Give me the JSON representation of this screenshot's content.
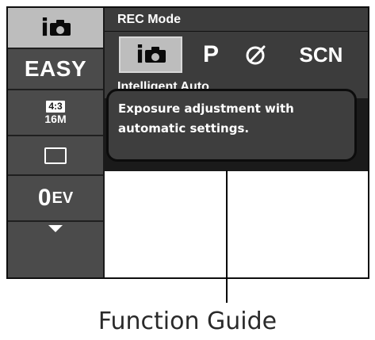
{
  "sidebar": {
    "items": [
      {
        "type": "mode-icon",
        "icon": "intelligent-auto-icon",
        "letter": "i",
        "selected": true
      },
      {
        "type": "text",
        "label": "EASY"
      },
      {
        "type": "ratio",
        "ratio": "4:3",
        "size": "16M"
      },
      {
        "type": "icon",
        "icon": "display-frame-icon"
      },
      {
        "type": "ev",
        "value": "0",
        "unit": "EV"
      },
      {
        "type": "icon",
        "icon": "scroll-down-icon"
      }
    ]
  },
  "header": {
    "title": "REC Mode"
  },
  "modes": [
    {
      "icon": "intelligent-auto-icon",
      "letter": "i",
      "selected": true
    },
    {
      "label": "P",
      "selected": false
    },
    {
      "icon": "creative-pen-icon",
      "selected": false
    },
    {
      "label": "SCN",
      "selected": false
    }
  ],
  "mode_name": "Intelligent Auto",
  "function_guide": {
    "lines": [
      "Exposure adjustment with",
      "automatic settings."
    ]
  },
  "caption": "Function Guide",
  "colors": {
    "panel": "#3c3c3c",
    "sidebar": "#4b4b4b",
    "selected": "#bdbdbd",
    "text": "#ffffff"
  }
}
